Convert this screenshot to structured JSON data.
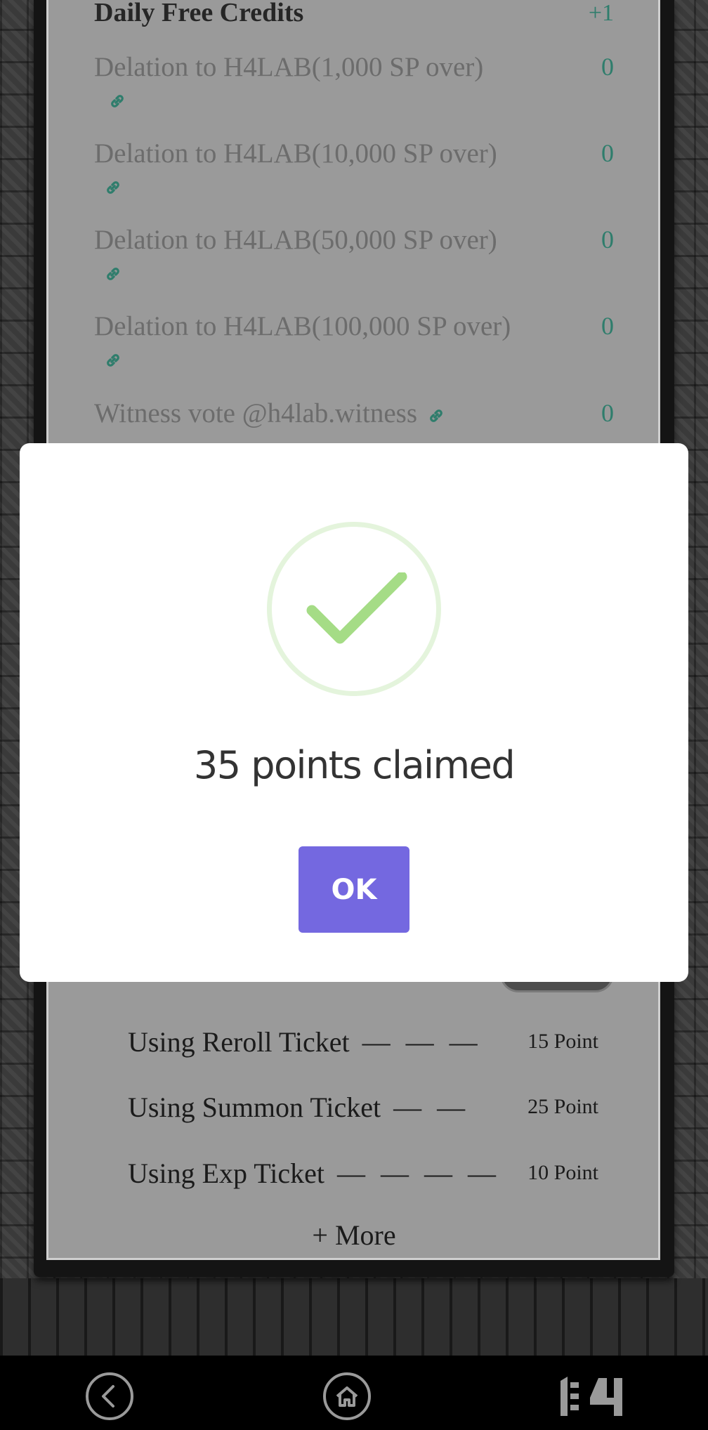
{
  "rewards": [
    {
      "label": "Daily Free Credits",
      "value": "+1",
      "link": false
    },
    {
      "label": "Delation to H4LAB(1,000 SP over)",
      "value": "0",
      "link": true
    },
    {
      "label": "Delation to H4LAB(10,000 SP over)",
      "value": "0",
      "link": true
    },
    {
      "label": "Delation to H4LAB(50,000 SP over)",
      "value": "0",
      "link": true
    },
    {
      "label": "Delation to H4LAB(100,000 SP over)",
      "value": "0",
      "link": true
    },
    {
      "label": "Witness vote @h4lab.witness",
      "value": "0",
      "link": true
    }
  ],
  "tickets": [
    {
      "label": "Using Reroll Ticket",
      "dash": "— — —",
      "points": "15 Point"
    },
    {
      "label": "Using Summon Ticket",
      "dash": "— —",
      "points": "25 Point"
    },
    {
      "label": "Using Exp Ticket",
      "dash": "— — — —",
      "points": "10 Point"
    }
  ],
  "more_label": "+ More",
  "modal": {
    "title": "35 points claimed",
    "ok_label": "OK",
    "icon": "checkmark-icon",
    "accent": "#a5dc86",
    "button_color": "#7468e0"
  },
  "navbar": {
    "icons": [
      "back-icon",
      "home-icon",
      "h4-logo"
    ]
  }
}
